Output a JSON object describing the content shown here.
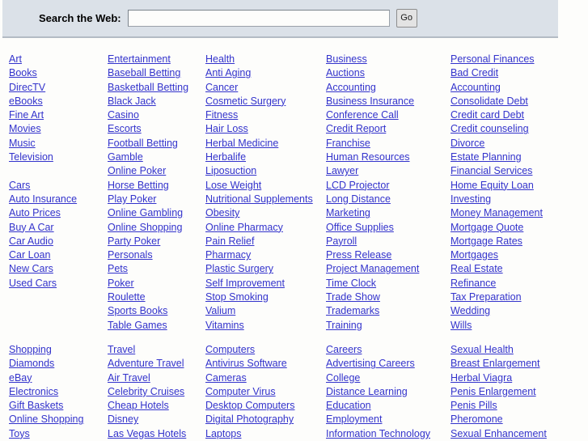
{
  "search": {
    "label": "Search the Web:",
    "value": "",
    "placeholder": "",
    "go_label": "Go"
  },
  "colors": {
    "panel_background": "#dbe1e8",
    "panel_border": "#b3bbc4",
    "link": "#3333cc",
    "page_background": "#fdfdfb"
  },
  "directory": {
    "blocks": [
      {
        "name": "top",
        "columns": [
          {
            "name": "arts-and-autos",
            "items": [
              "Art",
              "Books",
              "DirecTV",
              "eBooks",
              "Fine Art",
              "Movies",
              "Music",
              "Television",
              "",
              "Cars",
              "Auto Insurance",
              "Auto Prices",
              "Buy A Car",
              "Car Audio",
              "Car Loan",
              "New Cars",
              "Used Cars"
            ]
          },
          {
            "name": "entertainment",
            "items": [
              "Entertainment",
              "Baseball Betting",
              "Basketball Betting",
              "Black Jack",
              "Casino",
              "Escorts",
              "Football Betting",
              "Gamble",
              "Online Poker",
              "Horse Betting",
              "Play Poker",
              "Online Gambling",
              "Online Shopping",
              "Party Poker",
              "Personals",
              "Pets",
              "Poker",
              "Roulette",
              "Sports Books",
              "Table Games"
            ]
          },
          {
            "name": "health",
            "items": [
              "Health",
              "Anti Aging",
              "Cancer",
              "Cosmetic Surgery",
              "Fitness",
              "Hair Loss",
              "Herbal Medicine",
              "Herbalife",
              "Liposuction",
              "Lose Weight",
              "Nutritional Supplements",
              "Obesity",
              "Online Pharmacy",
              "Pain Relief",
              "Pharmacy",
              "Plastic Surgery",
              "Self Improvement",
              "Stop Smoking",
              "Valium",
              "Vitamins"
            ]
          },
          {
            "name": "business",
            "items": [
              "Business",
              "Auctions",
              "Accounting",
              "Business Insurance",
              "Conference Call",
              "Credit Report",
              "Franchise",
              "Human Resources",
              "Lawyer",
              "LCD Projector",
              "Long Distance",
              "Marketing",
              "Office Supplies",
              "Payroll",
              "Press Release",
              "Project Management",
              "Time Clock",
              "Trade Show",
              "Trademarks",
              "Training"
            ]
          },
          {
            "name": "personal-finances",
            "items": [
              "Personal Finances",
              "Bad Credit",
              "Accounting",
              "Consolidate Debt",
              "Credit card Debt",
              "Credit counseling",
              "Divorce",
              "Estate Planning",
              "Financial Services",
              "Home Equity Loan",
              "Investing",
              "Money Management",
              "Mortgage Quote",
              "Mortgage Rates",
              "Mortgages",
              "Real Estate",
              "Refinance",
              "Tax Preparation",
              "Wedding",
              "Wills"
            ]
          }
        ]
      },
      {
        "name": "bottom",
        "columns": [
          {
            "name": "shopping",
            "items": [
              "Shopping",
              "Diamonds",
              "eBay",
              "Electronics",
              "Gift Baskets",
              "Online Shopping",
              "Toys"
            ]
          },
          {
            "name": "travel",
            "items": [
              "Travel",
              "Adventure Travel",
              "Air Travel",
              "Celebrity Cruises",
              "Cheap Hotels",
              "Disney",
              "Las Vegas Hotels"
            ]
          },
          {
            "name": "computers",
            "items": [
              "Computers",
              "Antivirus Software",
              "Cameras",
              "Computer Virus",
              "Desktop Computers",
              "Digital Photography",
              "Laptops"
            ]
          },
          {
            "name": "careers",
            "items": [
              "Careers",
              "Advertising Careers",
              "College",
              "Distance Learning",
              "Education",
              "Employment",
              "Information Technology"
            ]
          },
          {
            "name": "sexual-health",
            "items": [
              "Sexual Health",
              "Breast Enlargement",
              "Herbal Viagra",
              "Penis Enlargement",
              "Penis Pills",
              "Pheromone",
              "Sexual Enhancement"
            ]
          }
        ]
      }
    ]
  }
}
